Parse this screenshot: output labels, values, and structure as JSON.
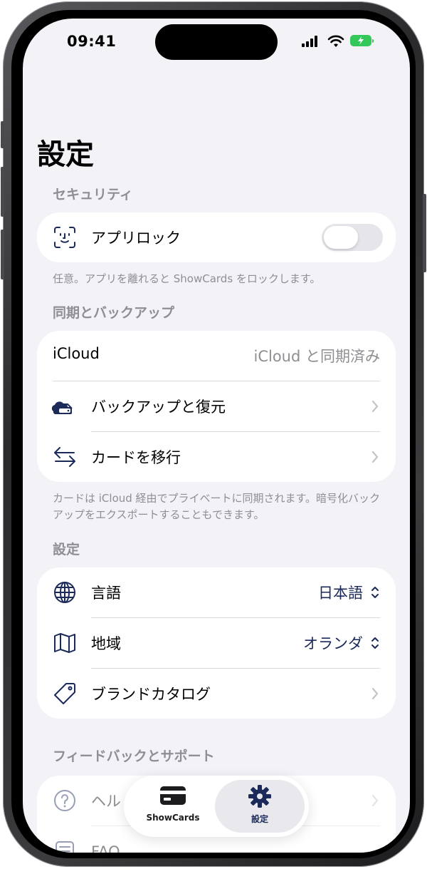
{
  "status_bar": {
    "time": "09:41"
  },
  "page_title": "設定",
  "security": {
    "header": "セキュリティ",
    "app_lock_label": "アプリロック",
    "app_lock_enabled": false,
    "footer": "任意。アプリを離れると ShowCards をロックします。"
  },
  "sync": {
    "header": "同期とバックアップ",
    "icloud_label": "iCloud",
    "icloud_status": "iCloud と同期済み",
    "backup_label": "バックアップと復元",
    "migrate_label": "カードを移行",
    "footer": "カードは iCloud 経由でプライベートに同期されます。暗号化バックアップをエクスポートすることもできます。"
  },
  "settings": {
    "header": "設定",
    "language_label": "言語",
    "language_value": "日本語",
    "region_label": "地域",
    "region_value": "オランダ",
    "brand_catalog_label": "ブランドカタログ"
  },
  "feedback": {
    "header": "フィードバックとサポート",
    "help_label": "ヘル",
    "faq_label": "FAQ"
  },
  "tab_bar": {
    "tabs": [
      {
        "label": "ShowCards",
        "icon": "card-icon",
        "active": false
      },
      {
        "label": "設定",
        "icon": "gear-icon",
        "active": true
      }
    ]
  },
  "colors": {
    "accent": "#1c2a5a",
    "background": "#f2f2f7",
    "secondary_text": "#8e8e93",
    "battery": "#34c759"
  }
}
